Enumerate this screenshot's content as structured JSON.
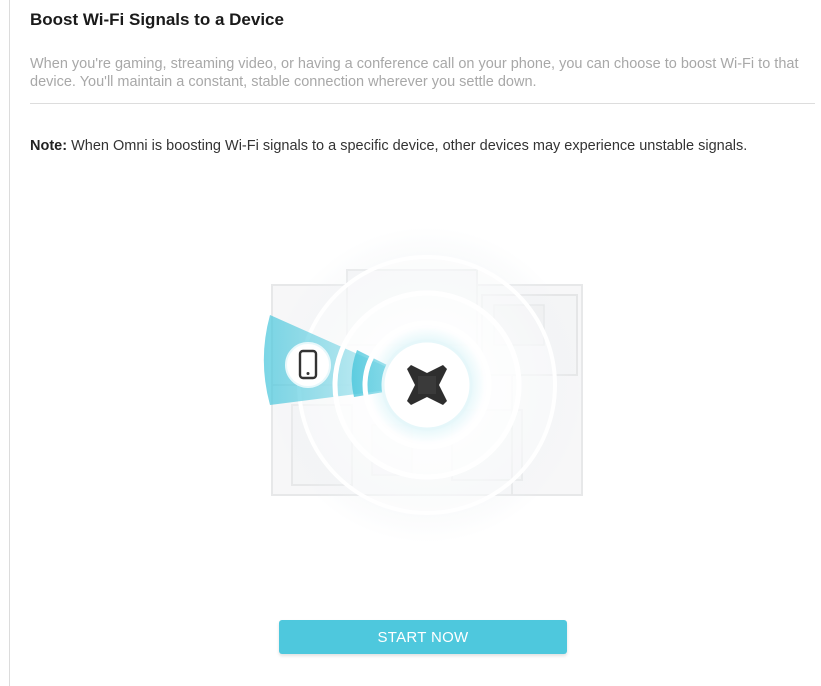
{
  "page": {
    "title": "Boost Wi-Fi Signals to a Device",
    "description": "When you're gaming, streaming video, or having a conference call on your phone, you can choose to boost Wi-Fi to that device. You'll maintain a constant, stable connection wherever you settle down.",
    "note_label": "Note:",
    "note_text": " When Omni is boosting Wi-Fi signals to a specific device, other devices may experience unstable signals."
  },
  "illustration": {
    "device_icon": "smartphone-icon",
    "router_icon": "omni-router-icon",
    "accent_color": "#4ec8dd"
  },
  "actions": {
    "start_label": "START NOW"
  }
}
